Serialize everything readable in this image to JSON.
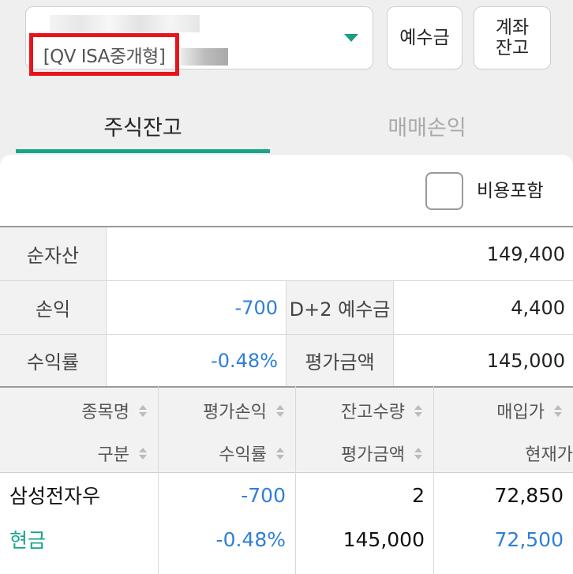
{
  "account": {
    "type_label": "[QV ISA중개형]"
  },
  "buttons": {
    "deposit": "예수금",
    "account_balance": "계좌\n잔고"
  },
  "tabs": [
    {
      "label": "주식잔고",
      "active": true
    },
    {
      "label": "매매손익",
      "active": false
    }
  ],
  "fee_option": {
    "label": "비용포함",
    "checked": false
  },
  "summary": {
    "net_asset_label": "순자산",
    "net_asset_value": "149,400",
    "pnl_label": "손익",
    "pnl_value": "-700",
    "d2_label": "D+2 예수금",
    "d2_value": "4,400",
    "return_label": "수익률",
    "return_value": "-0.48%",
    "eval_label": "평가금액",
    "eval_value": "145,000"
  },
  "holdings": {
    "headers_row1": [
      "종목명",
      "평가손익",
      "잔고수량",
      "매입가"
    ],
    "headers_row2": [
      "구분",
      "수익률",
      "평가금액",
      "현재가"
    ],
    "rows": [
      {
        "name": "삼성전자우",
        "category": "현금",
        "eval_pnl": "-700",
        "return": "-0.48%",
        "quantity": "2",
        "eval_amount": "145,000",
        "buy_price": "72,850",
        "current_price": "72,500"
      }
    ]
  },
  "colors": {
    "accent_green": "#17a58a",
    "negative_blue": "#2f7fd8",
    "highlight_red": "#e8141b"
  }
}
